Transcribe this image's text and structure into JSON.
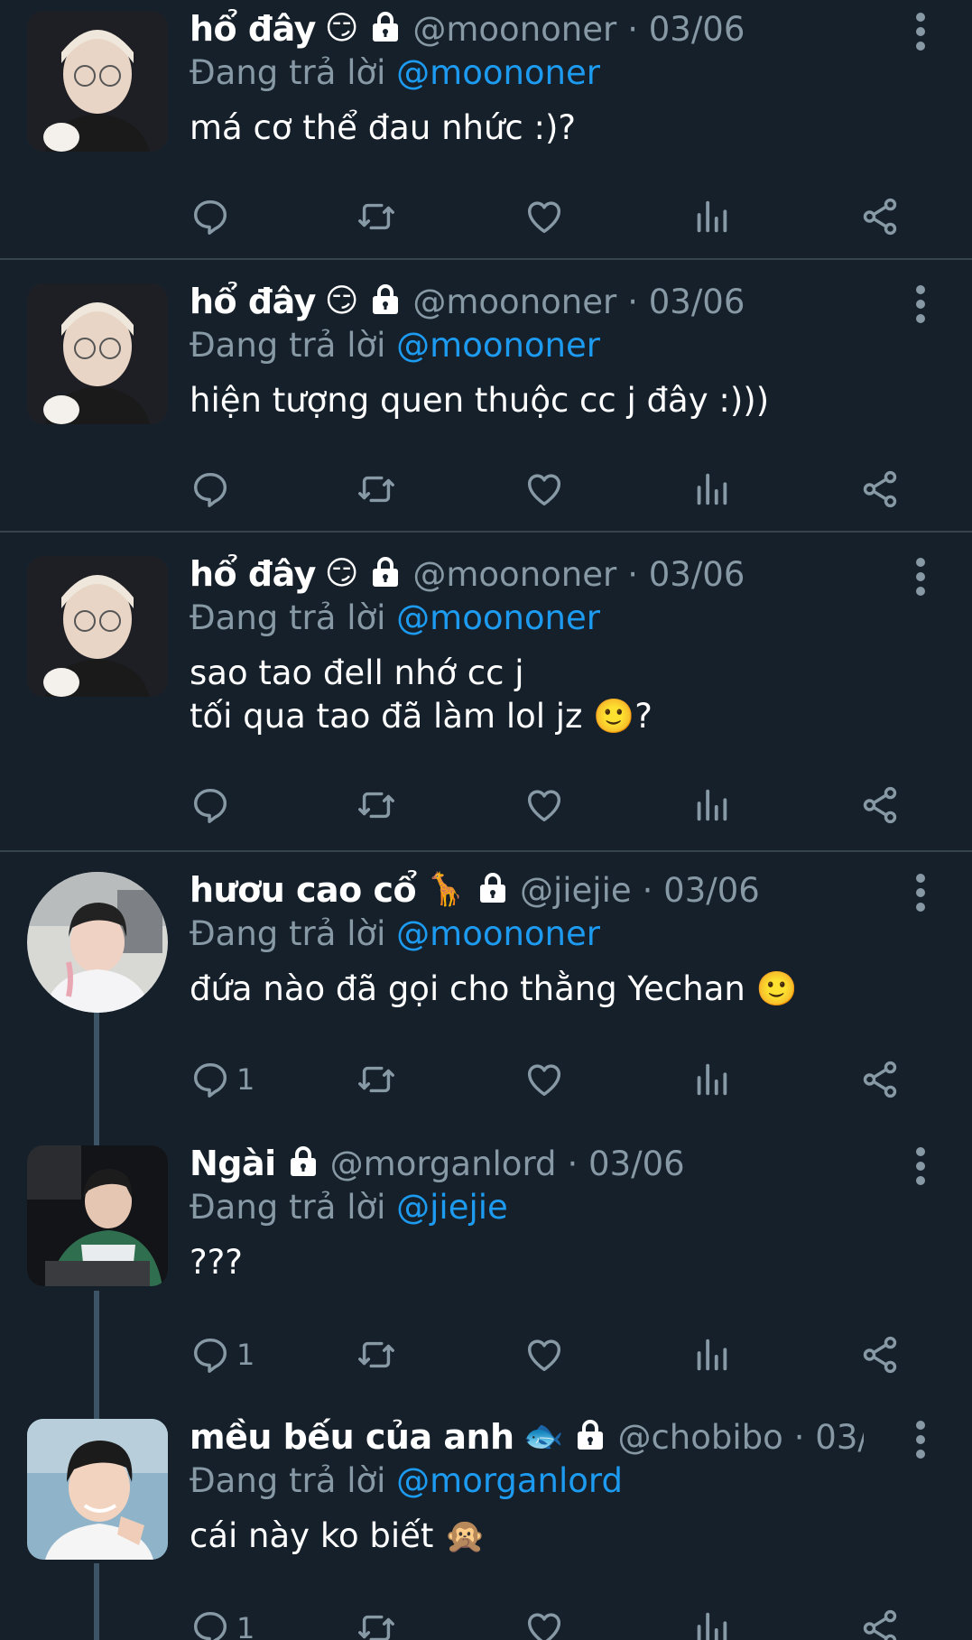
{
  "tweets": [
    {
      "author": "hổ đây",
      "emoji": "😏",
      "handle": "@moononer",
      "date": "· 03/06",
      "replying_prefix": "Đang trả lời ",
      "replying_to": "@moononer",
      "text": "má cơ thể đau nhức :)?",
      "reply_count": ""
    },
    {
      "author": "hổ đây",
      "emoji": "😏",
      "handle": "@moononer",
      "date": "· 03/06",
      "replying_prefix": "Đang trả lời ",
      "replying_to": "@moononer",
      "text": "hiện tượng quen thuộc cc j đây :)))",
      "reply_count": ""
    },
    {
      "author": "hổ đây",
      "emoji": "😏",
      "handle": "@moononer",
      "date": "· 03/06",
      "replying_prefix": "Đang trả lời ",
      "replying_to": "@moononer",
      "text": "sao tao đell nhớ cc j\ntối qua tao đã làm lol jz 🙂?",
      "reply_count": ""
    },
    {
      "author": "hươu cao cổ",
      "emoji": "🦒",
      "handle": "@jiejie",
      "date": "· 03/06",
      "replying_prefix": "Đang trả lời ",
      "replying_to": "@moononer",
      "text": "đứa nào đã gọi cho thằng Yechan 🙂",
      "reply_count": "1"
    },
    {
      "author": "Ngài",
      "emoji": "",
      "handle": "@morganlord",
      "date": "· 03/06",
      "replying_prefix": "Đang trả lời ",
      "replying_to": "@jiejie",
      "text": "???",
      "reply_count": "1"
    },
    {
      "author": "mều bếu của anh",
      "emoji": "🐟",
      "handle": "@chobibo",
      "date": "· 03/...",
      "replying_prefix": "Đang trả lời ",
      "replying_to": "@morganlord",
      "text": "cái này ko biết 🙊",
      "reply_count": "1"
    }
  ],
  "colors": {
    "background": "#15202b",
    "secondary_text": "#8899a6",
    "mention": "#1d9bf0",
    "divider": "#38444d"
  },
  "icons": [
    "reply-icon",
    "retweet-icon",
    "like-icon",
    "views-icon",
    "share-icon",
    "lock-icon",
    "more-icon"
  ]
}
